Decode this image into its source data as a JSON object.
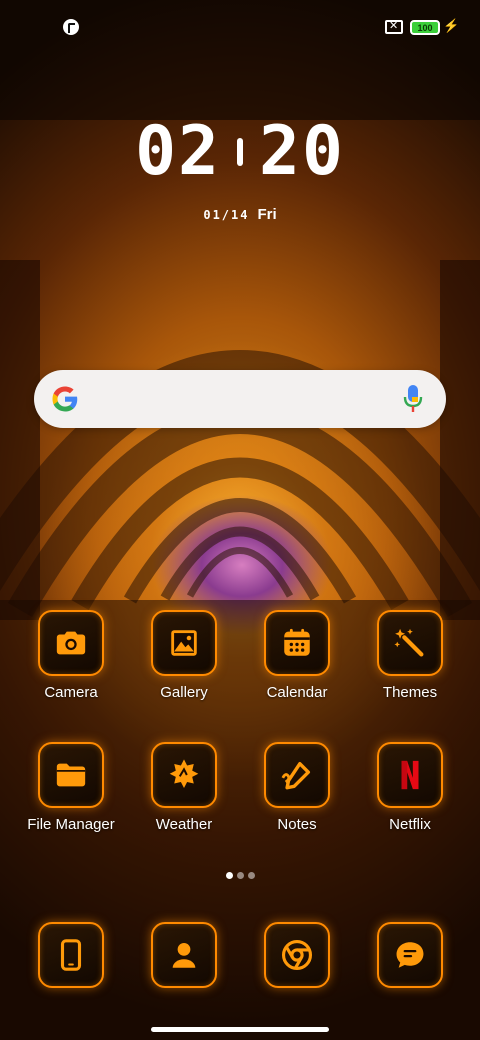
{
  "status_bar": {
    "battery_level": "100",
    "battery_color": "#3bcf3a",
    "sim_icon": "no-sim-icon",
    "charging_icon": "bolt-icon",
    "left_icon": "app-notification-icon"
  },
  "clock": {
    "hours": "02",
    "minutes": "20",
    "date": "01/14",
    "weekday": "Fri"
  },
  "search": {
    "logo": "google-logo",
    "mic_icon": "mic-icon"
  },
  "apps_row1": [
    {
      "label": "Camera",
      "icon": "camera-icon"
    },
    {
      "label": "Gallery",
      "icon": "gallery-icon"
    },
    {
      "label": "Calendar",
      "icon": "calendar-icon"
    },
    {
      "label": "Themes",
      "icon": "magic-wand-icon"
    }
  ],
  "apps_row2": [
    {
      "label": "File Manager",
      "icon": "folder-icon"
    },
    {
      "label": "Weather",
      "icon": "weather-icon"
    },
    {
      "label": "Notes",
      "icon": "pen-icon"
    },
    {
      "label": "Netflix",
      "icon": "netflix-icon"
    }
  ],
  "dock": [
    {
      "icon": "phone-icon"
    },
    {
      "icon": "contacts-icon"
    },
    {
      "icon": "chrome-icon"
    },
    {
      "icon": "messages-icon"
    }
  ],
  "pager": {
    "pages": 3,
    "active": 0
  },
  "accent_color": "#ff8a00"
}
